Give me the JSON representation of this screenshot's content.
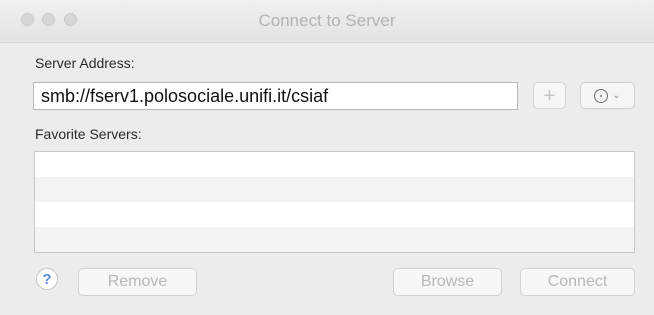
{
  "window": {
    "title": "Connect to Server"
  },
  "server": {
    "label": "Server Address:",
    "value": "smb://fserv1.polosociale.unifi.it/csiaf",
    "add_label": "+"
  },
  "favorites": {
    "label": "Favorite Servers:",
    "items": []
  },
  "footer": {
    "help_label": "?",
    "remove_label": "Remove",
    "browse_label": "Browse",
    "connect_label": "Connect"
  },
  "icons": {
    "recent": "clock-icon",
    "chevron": "chevron-down-icon"
  }
}
